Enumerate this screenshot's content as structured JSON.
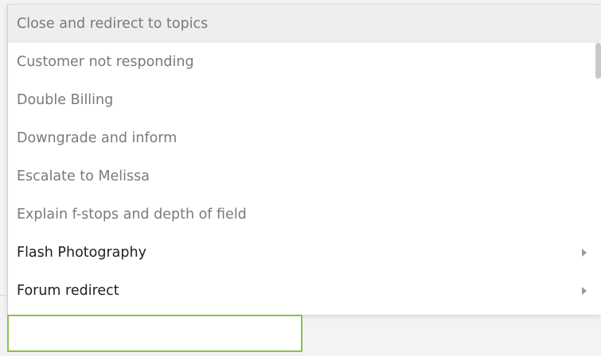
{
  "menu": {
    "items": [
      {
        "label": "Close and redirect to topics",
        "state": "highlighted",
        "submenu": false
      },
      {
        "label": "Customer not responding",
        "state": "normal",
        "submenu": false
      },
      {
        "label": "Double Billing",
        "state": "normal",
        "submenu": false
      },
      {
        "label": "Downgrade and inform",
        "state": "normal",
        "submenu": false
      },
      {
        "label": "Escalate to Melissa",
        "state": "normal",
        "submenu": false
      },
      {
        "label": "Explain f-stops and depth of field",
        "state": "normal",
        "submenu": false
      },
      {
        "label": "Flash Photography",
        "state": "category",
        "submenu": true
      },
      {
        "label": "Forum redirect",
        "state": "category",
        "submenu": true
      }
    ]
  },
  "input": {
    "value": "",
    "placeholder": ""
  },
  "colors": {
    "highlight_bg": "#eeeeee",
    "muted_text": "#7a7a7a",
    "dark_text": "#1f1f1f",
    "input_border": "#8bbf4b"
  },
  "icons": {
    "submenu": "chevron-right-icon"
  }
}
